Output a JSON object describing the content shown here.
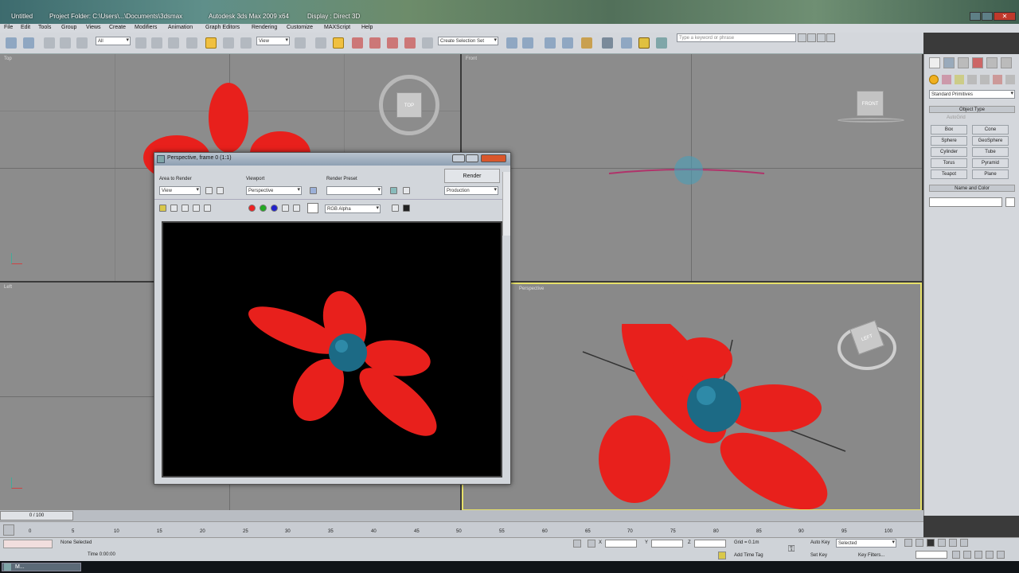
{
  "titlebar": {
    "doc": "Untitled",
    "project": "Project Folder: C:\\Users\\...\\Documents\\3dsmax",
    "app": "Autodesk 3ds Max  2009 x64",
    "display": "Display : Direct 3D"
  },
  "menu": [
    "File",
    "Edit",
    "Tools",
    "Group",
    "Views",
    "Create",
    "Modifiers",
    "Animation",
    "Graph Editors",
    "Rendering",
    "Customize",
    "MAXScript",
    "Help"
  ],
  "toolbar": {
    "filter_value": "All",
    "refcoord_value": "View",
    "selection_set_placeholder": "Create Selection Set",
    "search_placeholder": "Type a keyword or phrase"
  },
  "viewports": {
    "top": "Top",
    "front": "Front",
    "left": "Left",
    "perspective": "Perspective",
    "viewcube_top": "TOP",
    "viewcube_front": "FRONT",
    "viewcube_left": "LEFT"
  },
  "command_panel": {
    "category": "Standard Primitives",
    "object_type": "Object Type",
    "autogrid": "AutoGrid",
    "buttons": [
      "Box",
      "Cone",
      "Sphere",
      "GeoSphere",
      "Cylinder",
      "Tube",
      "Torus",
      "Pyramid",
      "Teapot",
      "Plane"
    ],
    "name_and_color": "Name and Color"
  },
  "render_window": {
    "title": "Perspective, frame 0 (1:1)",
    "area_to_render_label": "Area to Render",
    "area_to_render_value": "View",
    "viewport_label": "Viewport",
    "viewport_value": "Perspective",
    "render_preset_label": "Render Preset",
    "render_preset_value": "",
    "render_button": "Render",
    "production_value": "Production",
    "channel_value": "RGB Alpha"
  },
  "timeline": {
    "slider": "0 / 100",
    "ticks": [
      "0",
      "5",
      "10",
      "15",
      "20",
      "25",
      "30",
      "35",
      "40",
      "45",
      "50",
      "55",
      "60",
      "65",
      "70",
      "75",
      "80",
      "85",
      "90",
      "95",
      "100"
    ]
  },
  "status": {
    "none_selected": "None Selected",
    "time_label": "Time  0:00:00",
    "x_label": "X",
    "y_label": "Y",
    "z_label": "Z",
    "grid": "Grid = 0.1m",
    "add_time_tag": "Add Time Tag",
    "auto_key": "Auto Key",
    "selected": "Selected",
    "set_key": "Set Key",
    "key_filters": "Key Filters..."
  },
  "taskbar": {
    "app_short": "M..."
  },
  "colors": {
    "petal": "#e8201c",
    "center": "#1c6a85",
    "viewport_bg": "#8c8c8c",
    "active_border": "#e6e06a"
  }
}
